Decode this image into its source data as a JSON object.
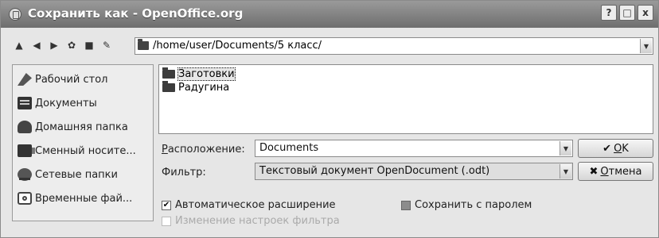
{
  "window": {
    "title": "Сохранить как - OpenOffice.org",
    "controls": {
      "help": "?",
      "maximize": "□",
      "close": "x"
    }
  },
  "toolbar": {
    "icons": [
      "up-icon",
      "back-icon",
      "forward-icon",
      "settings-icon",
      "new-folder-icon",
      "tools-icon"
    ],
    "path": "/home/user/Documents/5 класс/"
  },
  "places": [
    {
      "label": "Рабочий стол",
      "icon": "desktop-icon"
    },
    {
      "label": "Документы",
      "icon": "documents-icon"
    },
    {
      "label": "Домашняя папка",
      "icon": "home-folder-icon"
    },
    {
      "label": "Сменный носите...",
      "icon": "removable-media-icon"
    },
    {
      "label": "Сетевые папки",
      "icon": "network-folders-icon"
    },
    {
      "label": "Временные фай...",
      "icon": "temp-files-icon"
    }
  ],
  "files": [
    {
      "name": "Заготовки",
      "selected": true
    },
    {
      "name": "Радугина",
      "selected": false
    }
  ],
  "location": {
    "label_first": "Р",
    "label_rest": "асположение:",
    "value": "Documents"
  },
  "filter": {
    "label": "Фильтр:",
    "value": "Текстовый документ OpenDocument (.odt)"
  },
  "buttons": {
    "ok": {
      "icon": "✔",
      "label_first": "O",
      "label_rest": "K"
    },
    "cancel": {
      "icon": "✖",
      "label_first": "О",
      "label_rest": "тмена"
    }
  },
  "options": {
    "auto_extension": {
      "label": "Автоматическое расширение",
      "checked": true
    },
    "save_password": {
      "label": "Сохранить с паролем",
      "checked": false
    },
    "edit_filter": {
      "label": "Изменение настроек фильтра",
      "checked": false,
      "disabled": true
    }
  }
}
